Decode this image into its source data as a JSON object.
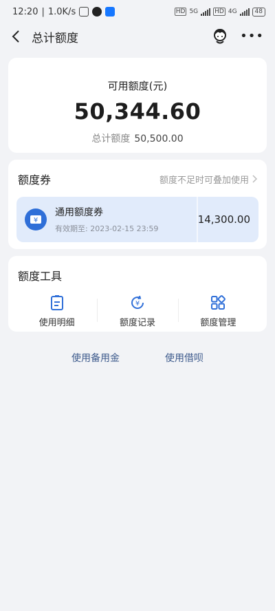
{
  "status_bar": {
    "time": "12:20",
    "speed": "1.0K/s",
    "battery": "48",
    "net_1": "5G",
    "net_2": "4G",
    "hd_1": "HD",
    "hd_2": "HD"
  },
  "nav": {
    "title": "总计额度"
  },
  "balance": {
    "label": "可用额度(元)",
    "value": "50,344.60",
    "total_label": "总计额度",
    "total_value": "50,500.00"
  },
  "coupon_section": {
    "title": "额度券",
    "hint": "额度不足时可叠加使用",
    "coupon": {
      "name": "通用额度券",
      "expiry": "有效期至: 2023-02-15 23:59",
      "amount": "14,300.00",
      "icon": "yen-ticket-icon"
    }
  },
  "tools_section": {
    "title": "额度工具",
    "items": [
      {
        "label": "使用明细",
        "icon": "clipboard-list-icon"
      },
      {
        "label": "额度记录",
        "icon": "yen-cycle-icon"
      },
      {
        "label": "额度管理",
        "icon": "grid-apps-icon"
      }
    ]
  },
  "links": {
    "reserve": "使用备用金",
    "jiebei": "使用借呗"
  },
  "colors": {
    "accent": "#2f6fd8",
    "coupon_bg": "#e1ebfb",
    "page_bg": "#f2f3f6",
    "link": "#3d5a8c"
  }
}
